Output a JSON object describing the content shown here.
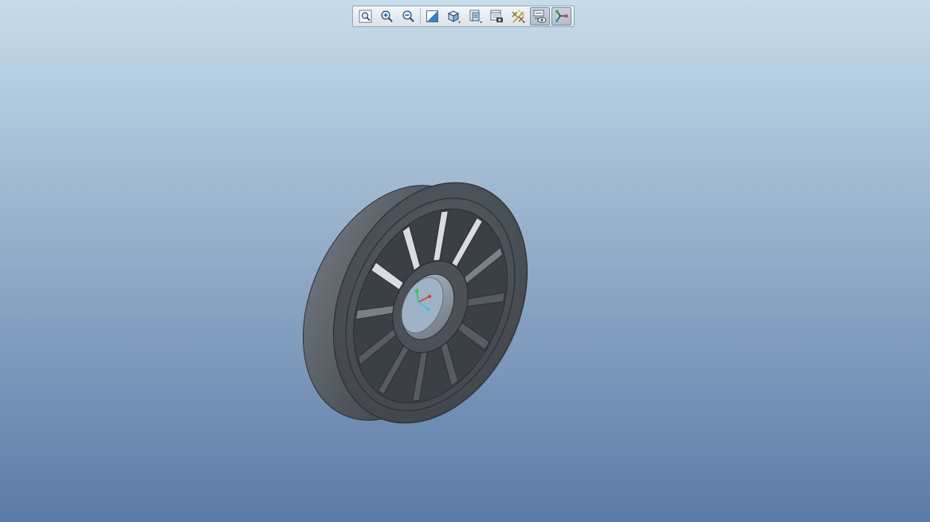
{
  "app": {
    "viewport_background_top": "#c6dcea",
    "viewport_background_bottom": "#5b7aa6"
  },
  "toolbar": {
    "buttons": [
      {
        "name": "refit-button",
        "icon": "zoom-fit-icon",
        "active": false
      },
      {
        "name": "zoom-in-button",
        "icon": "zoom-in-icon",
        "active": false
      },
      {
        "name": "zoom-out-button",
        "icon": "zoom-out-icon",
        "active": false
      },
      {
        "name": "repaint-button",
        "icon": "repaint-icon",
        "active": false
      },
      {
        "name": "display-style-button",
        "icon": "shaded-cube-icon",
        "active": false
      },
      {
        "name": "saved-orientations-button",
        "icon": "saved-views-icon",
        "active": false
      },
      {
        "name": "view-manager-button",
        "icon": "view-manager-icon",
        "active": false
      },
      {
        "name": "datum-display-button",
        "icon": "datum-display-icon",
        "active": false
      },
      {
        "name": "annotation-display-button",
        "icon": "annotation-display-icon",
        "active": true
      },
      {
        "name": "spin-center-button",
        "icon": "spin-center-icon",
        "active": true
      }
    ]
  },
  "model": {
    "part_color": "#4a4f56",
    "coordinate_axes": {
      "x_color": "#e23a3a",
      "y_color": "#39c24a",
      "z_color": "#33c6d8"
    }
  }
}
